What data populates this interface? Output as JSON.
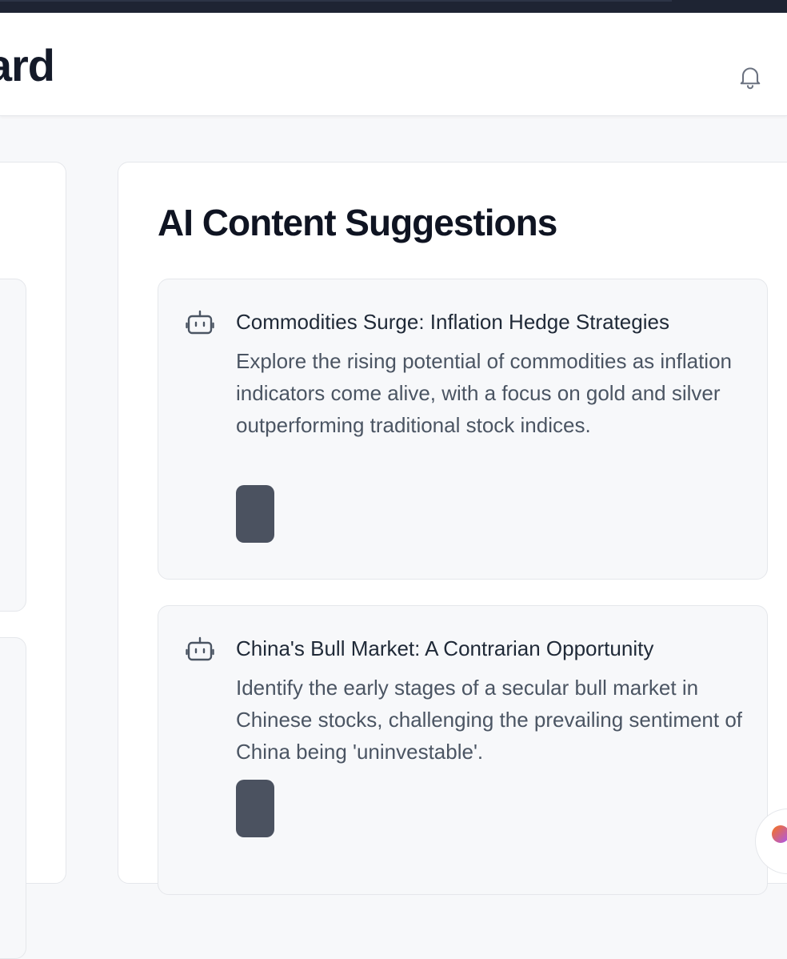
{
  "header": {
    "title": "ard",
    "notification_icon": "bell-icon"
  },
  "section": {
    "title": "AI Content Suggestions"
  },
  "suggestions": [
    {
      "icon": "bot-icon",
      "title": "Commodities Surge: Inflation Hedge Strategies",
      "description": "Explore the rising potential of commodities as inflation indicators come alive, with a focus on gold and silver outperforming traditional stock indices."
    },
    {
      "icon": "bot-icon",
      "title": "China's Bull Market: A Contrarian Opportunity",
      "description": "Identify the early stages of a secular bull market in Chinese stocks, challenging the prevailing sentiment of China being 'uninvestable'."
    }
  ],
  "colors": {
    "header_bg": "#ffffff",
    "page_bg": "#f7f8fa",
    "card_bg": "#f7f8fa",
    "action_button": "#4b5260",
    "top_bar": "#1e2433"
  }
}
